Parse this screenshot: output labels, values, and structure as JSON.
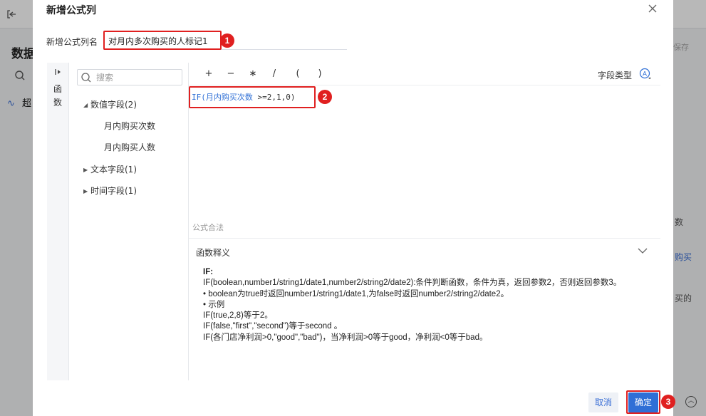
{
  "background": {
    "title_partial": "数据",
    "row_partial": "超",
    "right_save": "保存",
    "right_text_1": "数",
    "right_text_2": "购买",
    "right_text_3": "买的"
  },
  "dialog": {
    "title": "新增公式列",
    "name_label": "新增公式列名",
    "name_value": "对月内多次购买的人标记1"
  },
  "sidebar": {
    "rail_label": "函数",
    "search_placeholder": "搜索",
    "groups": [
      {
        "label": "数值字段(2)",
        "expanded": true,
        "fields": [
          "月内购买次数",
          "月内购买人数"
        ]
      },
      {
        "label": "文本字段(1)",
        "expanded": false
      },
      {
        "label": "时间字段(1)",
        "expanded": false
      }
    ]
  },
  "editor": {
    "operators": [
      "+",
      "−",
      "∗",
      "/",
      "(",
      ")"
    ],
    "type_label": "字段类型",
    "formula": {
      "prefix": "IF(",
      "field": "月内购买次数",
      "suffix": " >=2,1,0)"
    },
    "validity": "公式合法"
  },
  "explanation": {
    "header": "函数释义",
    "lines": [
      "IF:",
      "IF(boolean,number1/string1/date1,number2/string2/date2):条件判断函数，条件为真，返回参数2，否则返回参数3。",
      "• boolean为true时返回number1/string1/date1,为false时返回number2/string2/date2。",
      "• 示例",
      "IF(true,2,8)等于2。",
      "IF(false,\"first\",\"second\")等于second 。",
      "IF(各门店净利润>0,\"good\",\"bad\")，当净利润>0等于good，净利润<0等于bad。"
    ]
  },
  "footer": {
    "cancel_label": "取消",
    "ok_label": "确定"
  },
  "annotations": [
    "1",
    "2",
    "3"
  ],
  "colors": {
    "accent": "#2f6fd6",
    "annotation_red": "#e02020",
    "overlay": "#000000"
  }
}
